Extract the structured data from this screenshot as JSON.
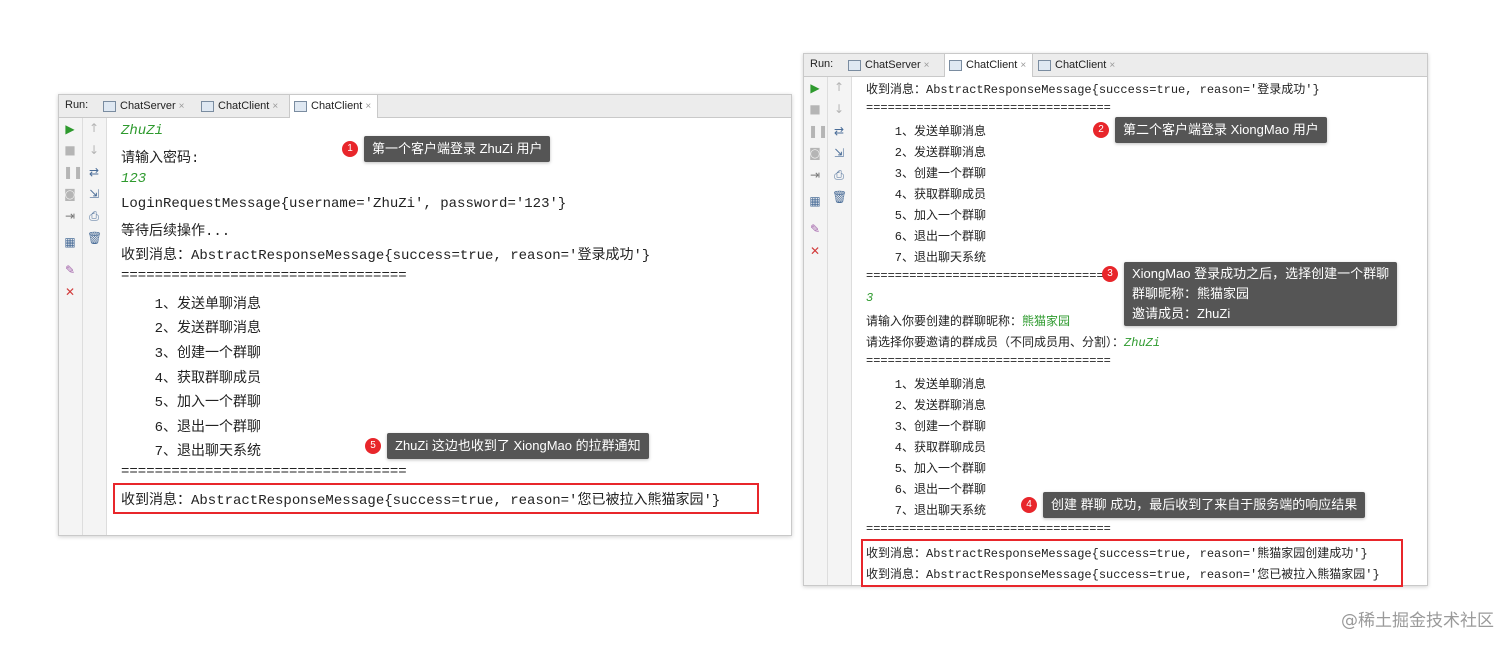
{
  "left_panel": {
    "run_label": "Run:",
    "tabs": [
      {
        "label": "ChatServer",
        "close": "×"
      },
      {
        "label": "ChatClient",
        "close": "×"
      },
      {
        "label": "ChatClient",
        "close": "×"
      }
    ],
    "lines": [
      "ZhuZi",
      "请输入密码:",
      "123",
      "LoginRequestMessage{username='ZhuZi', password='123'}",
      "等待后续操作...",
      "收到消息：AbstractResponseMessage{success=true, reason='登录成功'}",
      "==================================",
      "    1、发送单聊消息",
      "    2、发送群聊消息",
      "    3、创建一个群聊",
      "    4、获取群聊成员",
      "    5、加入一个群聊",
      "    6、退出一个群聊",
      "    7、退出聊天系统",
      "==================================",
      "收到消息：AbstractResponseMessage{success=true, reason='您已被拉入熊猫家园'}"
    ]
  },
  "right_panel": {
    "run_label": "Run:",
    "tabs": [
      {
        "label": "ChatServer",
        "close": "×"
      },
      {
        "label": "ChatClient",
        "close": "×"
      },
      {
        "label": "ChatClient",
        "close": "×"
      }
    ],
    "lines": [
      "收到消息：AbstractResponseMessage{success=true, reason='登录成功'}",
      "==================================",
      "    1、发送单聊消息",
      "    2、发送群聊消息",
      "    3、创建一个群聊",
      "    4、获取群聊成员",
      "    5、加入一个群聊",
      "    6、退出一个群聊",
      "    7、退出聊天系统",
      "==================================",
      "3",
      "请输入你要创建的群聊昵称：",
      "熊猫家园",
      "请选择你要邀请的群成员（不同成员用、分割）：",
      "ZhuZi",
      "==================================",
      "    1、发送单聊消息",
      "    2、发送群聊消息",
      "    3、创建一个群聊",
      "    4、获取群聊成员",
      "    5、加入一个群聊",
      "    6、退出一个群聊",
      "    7、退出聊天系统",
      "==================================",
      "收到消息：AbstractResponseMessage{success=true, reason='熊猫家园创建成功'}",
      "收到消息：AbstractResponseMessage{success=true, reason='您已被拉入熊猫家园'}"
    ]
  },
  "callouts": [
    {
      "num": "1",
      "text": "第一个客户端登录 ZhuZi 用户"
    },
    {
      "num": "2",
      "text": "第二个客户端登录 XiongMao 用户"
    },
    {
      "num": "3",
      "line1": "XiongMao 登录成功之后，选择创建一个群聊",
      "line2": "群聊昵称：熊猫家园",
      "line3": "邀请成员：ZhuZi"
    },
    {
      "num": "4",
      "text": "创建 群聊 成功，最后收到了来自于服务端的响应结果"
    },
    {
      "num": "5",
      "text": "ZhuZi 这边也收到了 XiongMao 的拉群通知"
    }
  ],
  "watermark": "@稀土掘金技术社区",
  "colors": {
    "highlight": "#e8262b",
    "callout_bg": "#555555",
    "input_text": "#2e9a2e"
  },
  "gutter_icons": [
    "run-icon",
    "up-icon",
    "down-icon",
    "stop-icon",
    "pause-icon",
    "wrap-icon",
    "camera-icon",
    "scroll-icon",
    "login-icon",
    "print-icon",
    "layout-icon",
    "trash-icon",
    "pin-icon",
    "close-icon"
  ]
}
